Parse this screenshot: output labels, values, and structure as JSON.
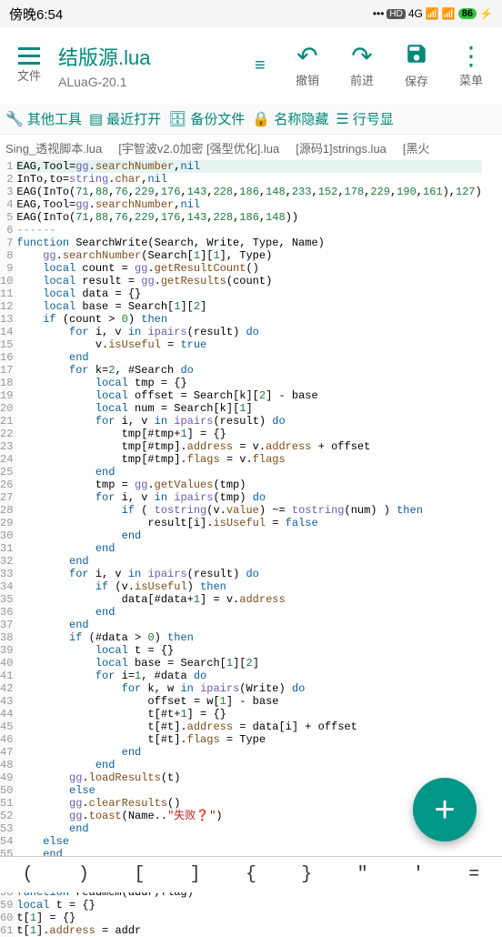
{
  "status": {
    "time": "傍晚6:54",
    "hd": "HD",
    "net": "4G",
    "battery": "86"
  },
  "toolbar": {
    "file": "文件",
    "title": "结版源.lua",
    "subtitle": "ALuaG-20.1",
    "undo": "撤销",
    "redo": "前进",
    "save": "保存",
    "menu": "菜单"
  },
  "subbar": {
    "other": "其他工具",
    "recent": "最近打开",
    "backup": "备份文件",
    "hide": "名称隐藏",
    "lineno": "行号显"
  },
  "tabs": {
    "t1": "Sing_透视脚本.lua",
    "t2": "[宇智波v2.0加密 [强型优化].lua",
    "t3": "[源码1]strings.lua",
    "t4": "[黑火"
  },
  "symbols": {
    "s1": "(",
    "s2": ")",
    "s3": "[",
    "s4": "]",
    "s5": "{",
    "s6": "}",
    "s7": "\"",
    "s8": "'",
    "s9": "="
  },
  "code_lines": [
    "EAG,Tool=gg.searchNumber,nil",
    "InTo,to=string.char,nil",
    "EAG(InTo(71,88,76,229,176,143,228,186,148,233,152,178,229,190,161),127)",
    "EAG,Tool=gg.searchNumber,nil",
    "EAG(InTo(71,88,76,229,176,143,228,186,148))",
    "------",
    "function SearchWrite(Search, Write, Type, Name)",
    "    gg.searchNumber(Search[1][1], Type)",
    "    local count = gg.getResultCount()",
    "    local result = gg.getResults(count)",
    "    local data = {}",
    "    local base = Search[1][2]",
    "    if (count > 0) then",
    "        for i, v in ipairs(result) do",
    "            v.isUseful = true",
    "        end",
    "        for k=2, #Search do",
    "            local tmp = {}",
    "            local offset = Search[k][2] - base",
    "            local num = Search[k][1]",
    "            for i, v in ipairs(result) do",
    "                tmp[#tmp+1] = {}",
    "                tmp[#tmp].address = v.address + offset",
    "                tmp[#tmp].flags = v.flags",
    "            end",
    "            tmp = gg.getValues(tmp)",
    "            for i, v in ipairs(tmp) do",
    "                if ( tostring(v.value) ~= tostring(num) ) then",
    "                    result[i].isUseful = false",
    "                end",
    "            end",
    "        end",
    "        for i, v in ipairs(result) do",
    "            if (v.isUseful) then",
    "                data[#data+1] = v.address",
    "            end",
    "        end",
    "        if (#data > 0) then",
    "            local t = {}",
    "            local base = Search[1][2]",
    "            for i=1, #data do",
    "                for k, w in ipairs(Write) do",
    "                    offset = w[1] - base",
    "                    t[#t+1] = {}",
    "                    t[#t].address = data[i] + offset",
    "                    t[#t].flags = Type",
    "                end",
    "            end",
    "        gg.loadResults(t)",
    "        else",
    "        gg.clearResults()",
    "        gg.toast(Name..\"失败❓\")",
    "        end",
    "    else",
    "    end",
    "end",
    "",
    "function readmem(addr,flag)",
    "local t = {}",
    "t[1] = {}",
    "t[1].address = addr"
  ],
  "chart_data": null
}
